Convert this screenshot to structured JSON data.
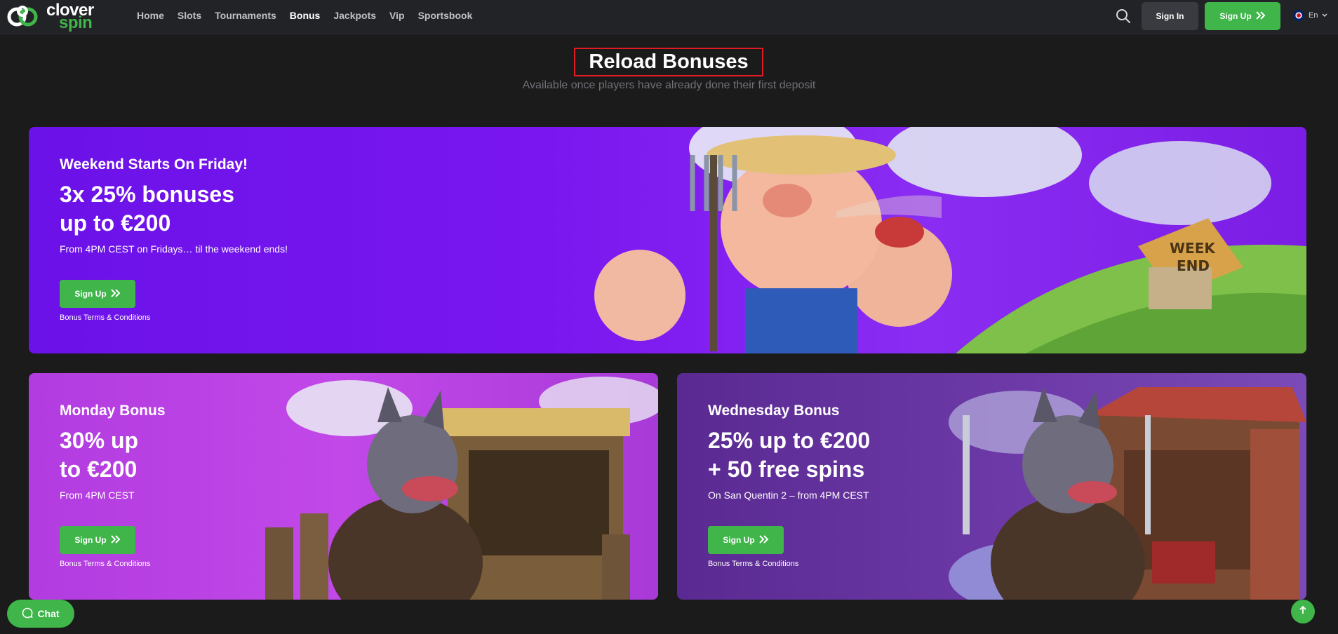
{
  "header": {
    "logo": {
      "line1": "clover",
      "line2": "spin"
    },
    "nav": [
      {
        "label": "Home"
      },
      {
        "label": "Slots"
      },
      {
        "label": "Tournaments"
      },
      {
        "label": "Bonus",
        "active": true
      },
      {
        "label": "Jackpots"
      },
      {
        "label": "Vip"
      },
      {
        "label": "Sportsbook"
      }
    ],
    "search_icon": "search-icon",
    "signin_label": "Sign In",
    "signup_label": "Sign Up",
    "language": "En"
  },
  "page": {
    "title": "Reload Bonuses",
    "subtitle": "Available once players have already done their first deposit"
  },
  "bonuses": [
    {
      "kicker": "Weekend Starts On Friday!",
      "headline_line1": "3x 25% bonuses",
      "headline_line2": "up to €200",
      "description": "From 4PM CEST on Fridays… til the weekend ends!",
      "button": "Sign Up",
      "terms": "Bonus Terms & Conditions",
      "sign_text_line1": "WEEK",
      "sign_text_line2": "END"
    },
    {
      "kicker": "Monday Bonus",
      "headline_line1": "30% up",
      "headline_line2": "to €200",
      "description": "From 4PM CEST",
      "button": "Sign Up",
      "terms": "Bonus Terms & Conditions"
    },
    {
      "kicker": "Wednesday Bonus",
      "headline_line1": "25% up to €200",
      "headline_line2": "+ 50 free spins",
      "description": "On San Quentin 2 – from 4PM CEST",
      "button": "Sign Up",
      "terms": "Bonus Terms & Conditions"
    }
  ],
  "footer": {
    "chat_label": "Chat",
    "scroll_top_icon": "arrow-up-icon"
  },
  "colors": {
    "brand_green": "#3fb54a",
    "background": "#1b1b1b",
    "highlight_border": "#e01b24"
  }
}
